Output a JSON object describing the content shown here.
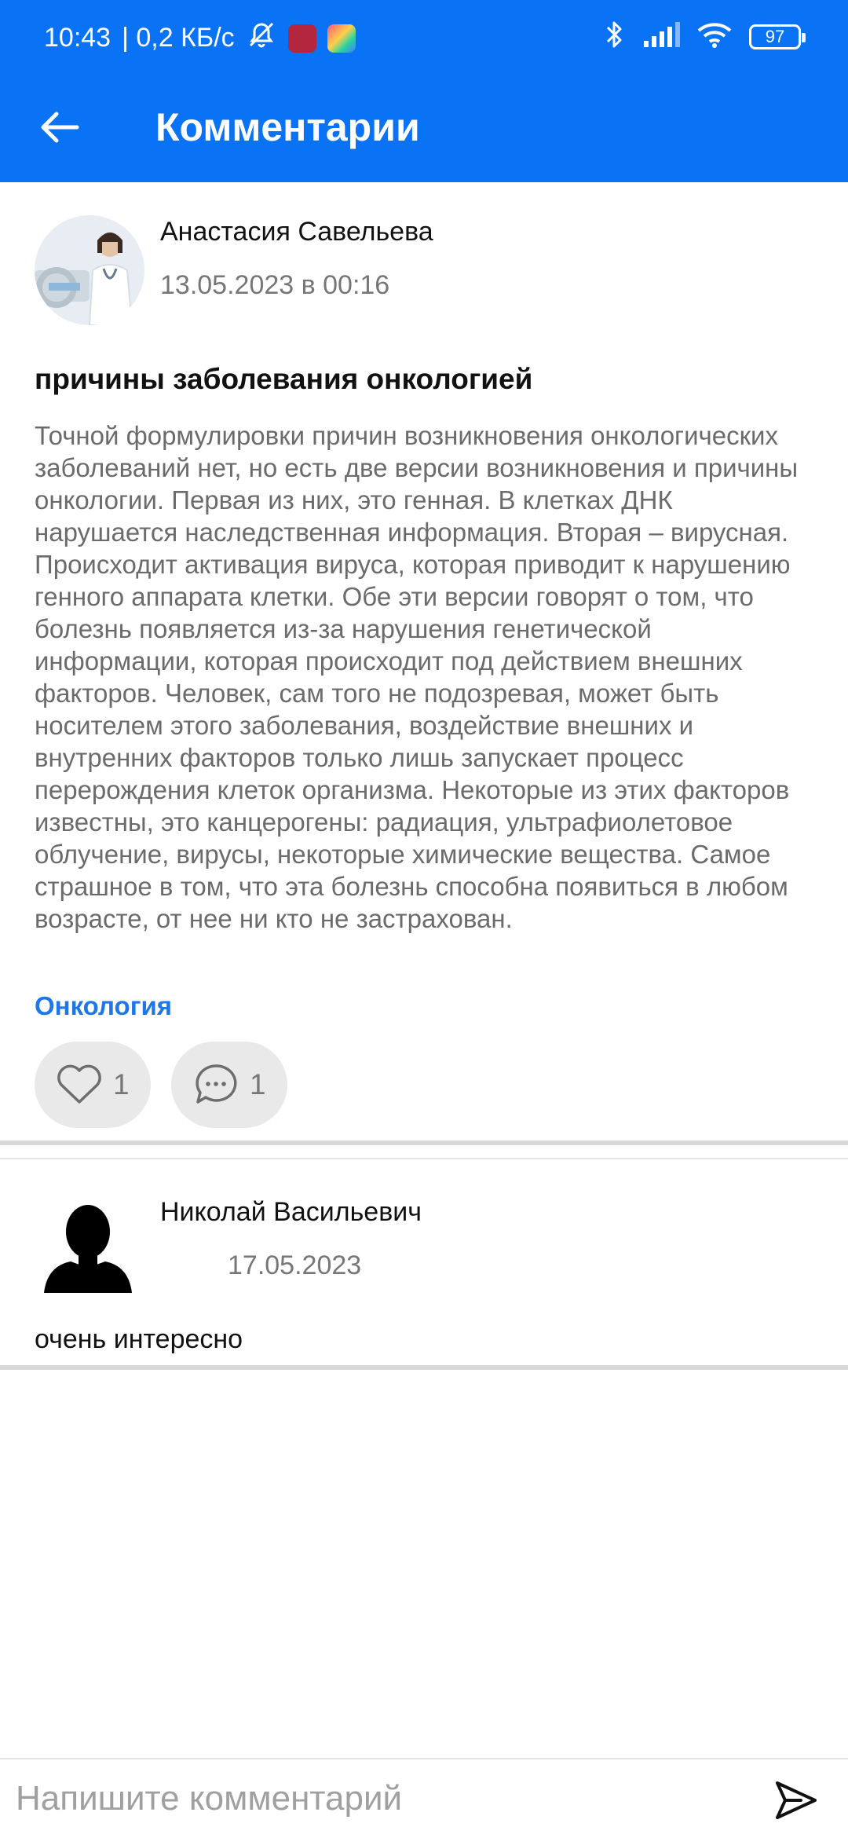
{
  "status_bar": {
    "time": "10:43",
    "network_speed": "| 0,2 КБ/с",
    "battery_level": "97"
  },
  "header": {
    "title": "Комментарии"
  },
  "post": {
    "author": "Анастасия Савельева",
    "date": "13.05.2023 в 00:16",
    "title": "причины заболевания онкологией",
    "body": "Точной формулировки причин возникновения онкологических заболеваний нет, но есть две версии возникновения и причины онкологии. Первая из них, это генная. В клетках ДНК нарушается наследственная информация. Вторая – вирусная. Происходит активация вируса, которая приводит к нарушению генного аппарата клетки. Обе эти версии говорят о том, что болезнь появляется из-за нарушения генетической информации, которая происходит под действием внешних факторов. Человек, сам того не подозревая, может быть носителем этого заболевания, воздействие внешних и внутренних факторов только лишь запускает процесс перерождения клеток организма. Некоторые из этих факторов известны, это канцерогены: радиация, ультрафиолетовое облучение, вирусы, некоторые химические вещества. Самое страшное в том, что эта болезнь способна появиться в любом возрасте, от нее ни кто не застрахован.",
    "tag": "Онкология",
    "likes": "1",
    "comments": "1"
  },
  "comments": [
    {
      "author": "Николай Васильевич",
      "date": "17.05.2023",
      "text": "очень интересно"
    }
  ],
  "input": {
    "placeholder": "Напишите комментарий"
  },
  "colors": {
    "brand": "#0a72f4",
    "tag": "#1e77e8",
    "pill": "#e9e9e9"
  }
}
